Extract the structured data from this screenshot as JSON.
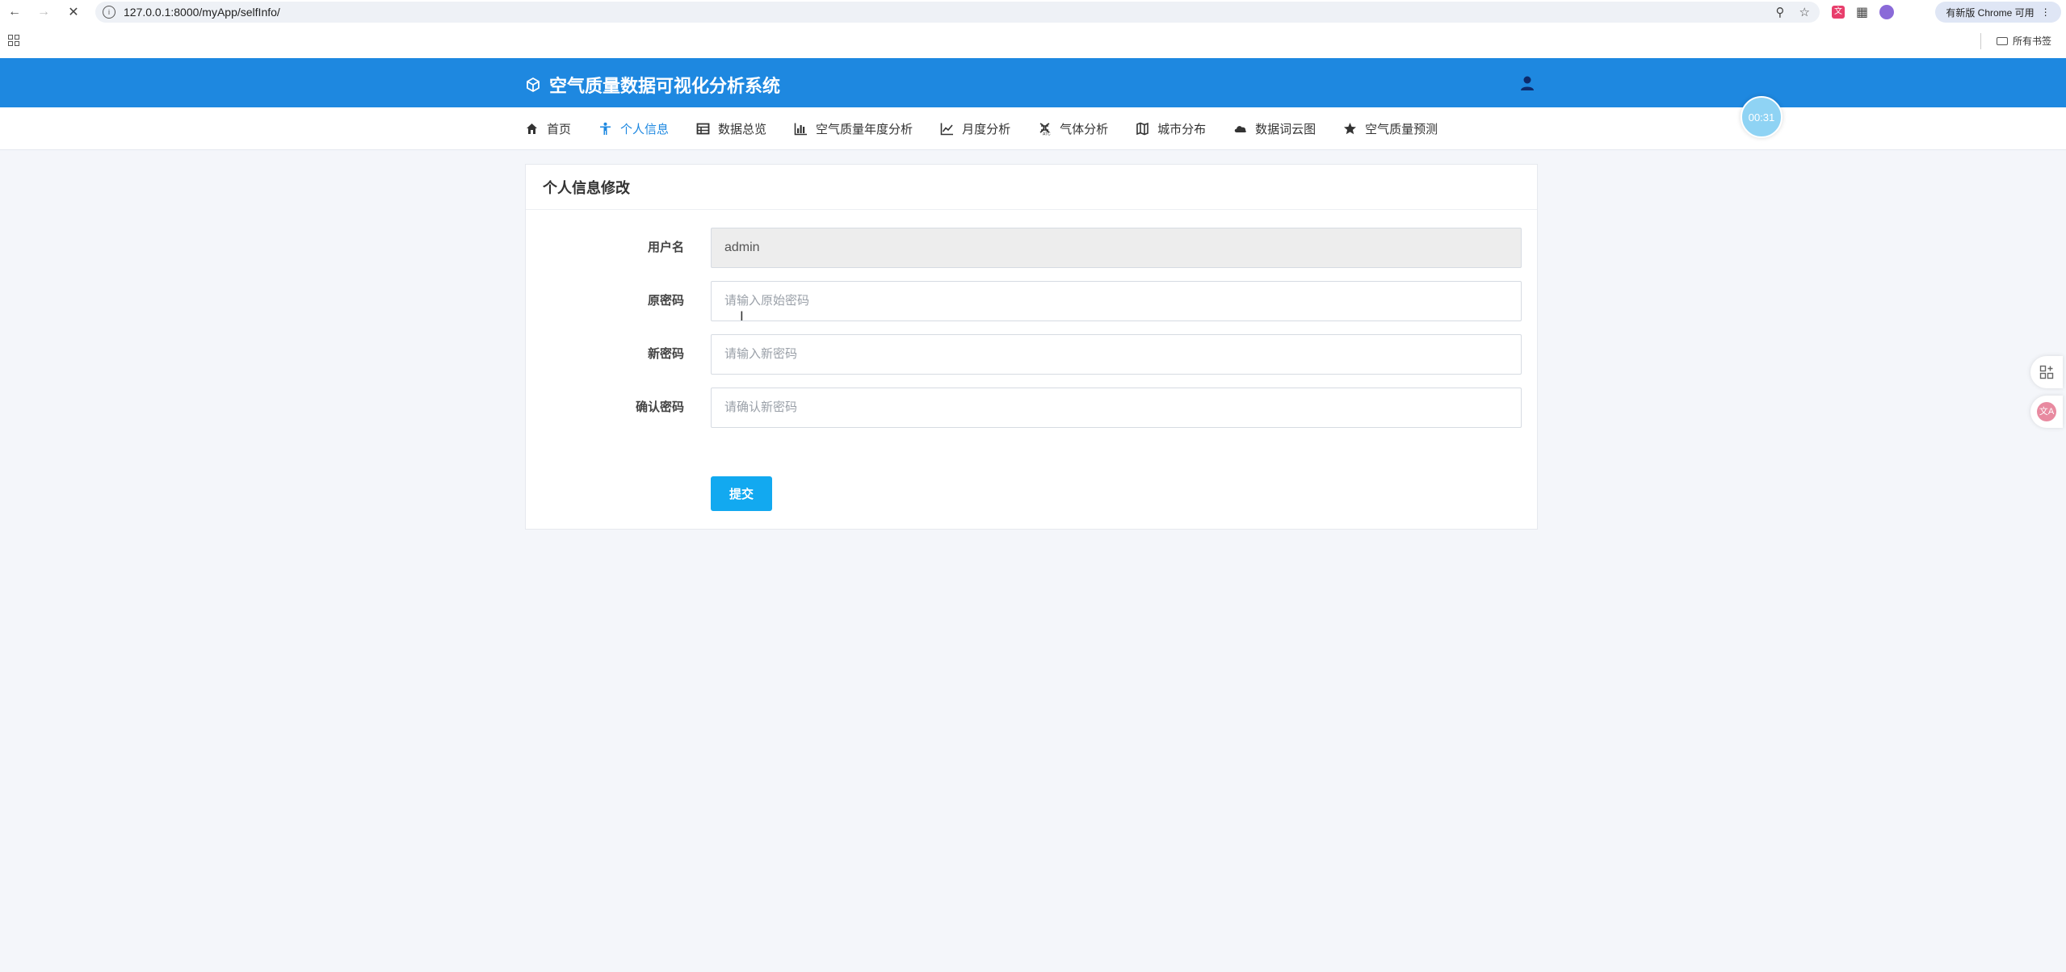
{
  "browser": {
    "url": "127.0.0.1:8000/myApp/selfInfo/",
    "update_label": "有新版 Chrome 可用",
    "bookmarks_label": "所有书签"
  },
  "header": {
    "title": "空气质量数据可视化分析系统"
  },
  "nav": {
    "items": [
      {
        "label": "首页",
        "icon": "home-icon"
      },
      {
        "label": "个人信息",
        "icon": "person-icon",
        "active": true
      },
      {
        "label": "数据总览",
        "icon": "table-icon"
      },
      {
        "label": "空气质量年度分析",
        "icon": "bar-chart-icon"
      },
      {
        "label": "月度分析",
        "icon": "line-chart-icon"
      },
      {
        "label": "气体分析",
        "icon": "molecule-icon"
      },
      {
        "label": "城市分布",
        "icon": "map-icon"
      },
      {
        "label": "数据词云图",
        "icon": "cloud-icon"
      },
      {
        "label": "空气质量预测",
        "icon": "star-icon"
      }
    ]
  },
  "timer": "00:31",
  "form": {
    "title": "个人信息修改",
    "username": {
      "label": "用户名",
      "value": "admin"
    },
    "old_password": {
      "label": "原密码",
      "placeholder": "请输入原始密码"
    },
    "new_password": {
      "label": "新密码",
      "placeholder": "请输入新密码"
    },
    "confirm_password": {
      "label": "确认密码",
      "placeholder": "请确认新密码"
    },
    "submit_label": "提交"
  },
  "colors": {
    "header_bg": "#1e88e0",
    "active_nav": "#1e88e0",
    "submit_bg": "#12a9f0",
    "page_bg": "#f4f6fa"
  }
}
